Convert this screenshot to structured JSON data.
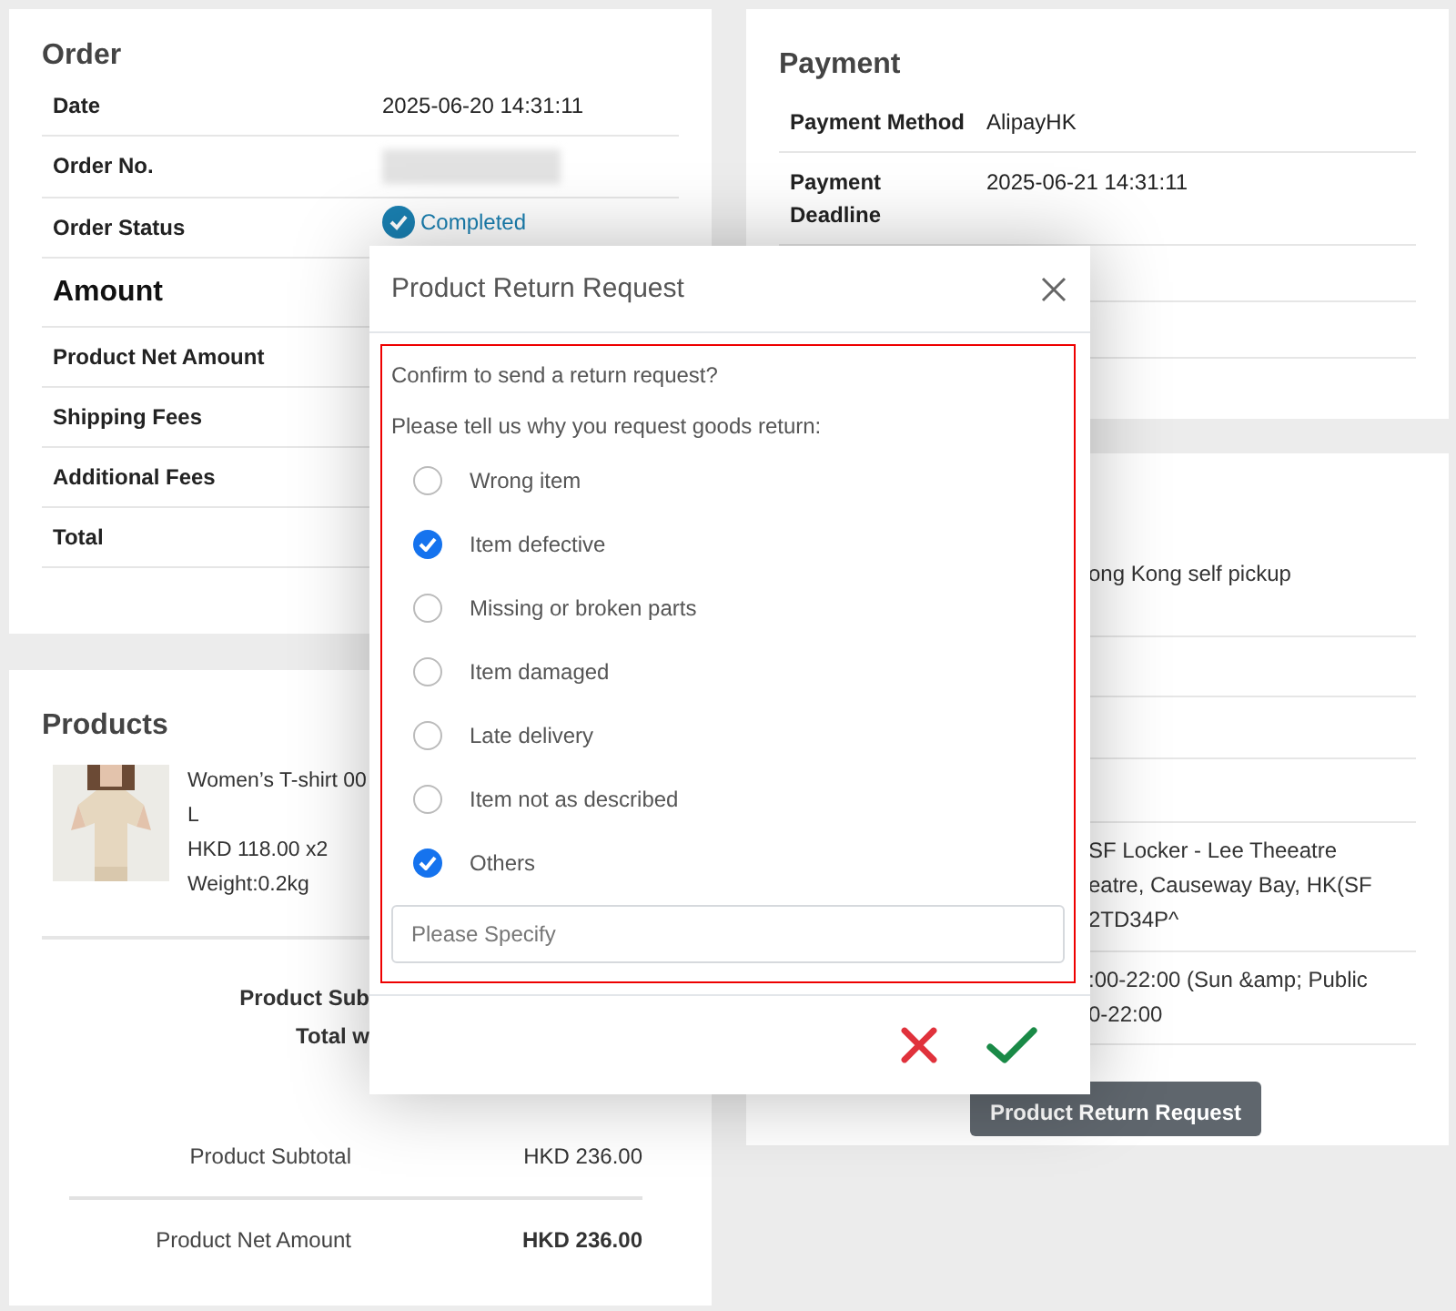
{
  "order": {
    "title": "Order",
    "rows": [
      {
        "label": "Date",
        "kind": "text",
        "value": "2025-06-20 14:31:11"
      },
      {
        "label": "Order No.",
        "kind": "blurred"
      },
      {
        "label": "Order Status",
        "kind": "status",
        "value": "Completed"
      }
    ],
    "amount_title": "Amount",
    "amount_rows": [
      {
        "label": "Product Net Amount"
      },
      {
        "label": "Shipping Fees"
      },
      {
        "label": "Additional Fees"
      },
      {
        "label": "Total"
      }
    ]
  },
  "products": {
    "title": "Products",
    "items": [
      {
        "lines": [
          "Women’s T-shirt 00",
          "L",
          "HKD 118.00 x2",
          "Weight:0.2kg"
        ]
      }
    ],
    "summary": [
      "Product Sub",
      "Total w"
    ],
    "totals": [
      {
        "label": "Product Subtotal",
        "value": "HKD 236.00",
        "bold": false
      },
      {
        "label": "Product Net Amount",
        "value": "HKD 236.00",
        "bold": true
      }
    ]
  },
  "payment": {
    "title": "Payment",
    "rows": [
      {
        "label": "Payment Method",
        "value": "AlipayHK"
      },
      {
        "label": "Payment Deadline",
        "value": "2025-06-21 14:31:11"
      }
    ]
  },
  "delivery": {
    "rows": [
      {
        "lines": [
          "ong Kong self pickup"
        ]
      },
      {
        "lines": [
          "SF Locker - Lee Theeatre",
          "eatre, Causeway Bay, HK(SF",
          "2TD34P^"
        ]
      },
      {
        "lines": [
          ":00-22:00 (Sun &amp; Public",
          "0-22:00"
        ]
      }
    ],
    "button": "Product Return Request"
  },
  "dialog": {
    "title": "Product Return Request",
    "question": "Confirm to send a return request?",
    "prompt": "Please tell us why you request goods return:",
    "reasons": [
      {
        "label": "Wrong item",
        "selected": false
      },
      {
        "label": "Item defective",
        "selected": true
      },
      {
        "label": "Missing or broken parts",
        "selected": false
      },
      {
        "label": "Item damaged",
        "selected": false
      },
      {
        "label": "Late delivery",
        "selected": false
      },
      {
        "label": "Item not as described",
        "selected": false
      },
      {
        "label": "Others",
        "selected": true
      }
    ],
    "specify_placeholder": "Please Specify",
    "actions": [
      {
        "kind": "cancel"
      },
      {
        "kind": "confirm"
      }
    ]
  }
}
